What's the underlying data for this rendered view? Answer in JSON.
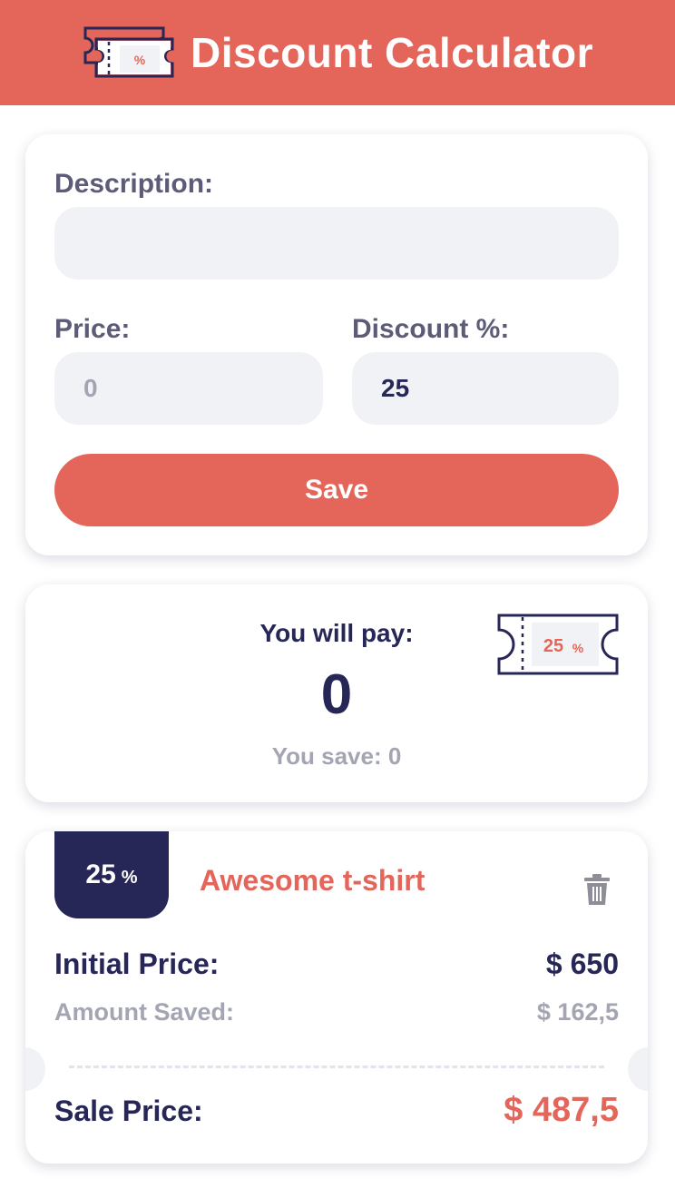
{
  "app": {
    "title": "Discount Calculator",
    "logo_text": "%"
  },
  "form": {
    "description_label": "Description:",
    "description_value": "",
    "price_label": "Price:",
    "price_placeholder": "0",
    "price_value": "",
    "discount_label": "Discount %:",
    "discount_value": "25",
    "save_label": "Save"
  },
  "result": {
    "pay_label": "You will pay:",
    "pay_value": "0",
    "save_text": "You save: 0",
    "badge_value": "25",
    "badge_unit": "%"
  },
  "items": [
    {
      "discount": "25",
      "discount_unit": "%",
      "title": "Awesome t-shirt",
      "initial_label": "Initial Price:",
      "initial_value": "$ 650",
      "saved_label": "Amount Saved:",
      "saved_value": "$ 162,5",
      "sale_label": "Sale Price:",
      "sale_value": "$ 487,5"
    }
  ],
  "colors": {
    "accent": "#e4665b",
    "navy": "#272757",
    "field_bg": "#f1f2f6",
    "muted": "#a3a5b3"
  },
  "icons": {
    "logo": "ticket-icon",
    "badge": "ticket-icon",
    "delete": "trash-icon"
  }
}
